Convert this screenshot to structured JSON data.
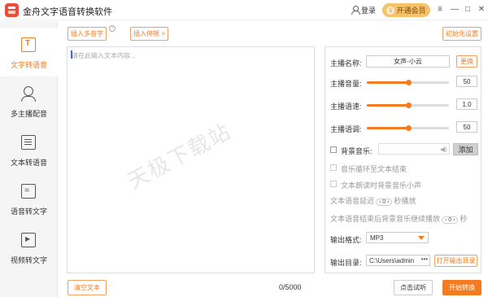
{
  "app": {
    "title": "金舟文字语音转换软件"
  },
  "header": {
    "login": "登录",
    "vip": "开通会员",
    "vip_icon": "♕"
  },
  "window": {
    "menu": "≡",
    "minimize": "—",
    "maximize": "□",
    "close": "✕"
  },
  "sidebar": {
    "items": [
      {
        "label": "文字转语音",
        "icon": "text-to-speech-icon"
      },
      {
        "label": "多主播配音",
        "icon": "multi-speaker-icon"
      },
      {
        "label": "文本转语音",
        "icon": "document-icon"
      },
      {
        "label": "语音转文字",
        "icon": "speech-to-text-icon"
      },
      {
        "label": "视频转文字",
        "icon": "video-icon"
      }
    ]
  },
  "toolbar": {
    "insert_polyphone": "插入多音字",
    "help": "?",
    "insert_pause": "插入停顿 >",
    "reset": "初始化设置"
  },
  "editor": {
    "placeholder": "请在此输入文本内容...",
    "watermark": "天极下载站",
    "counter": "0/5000"
  },
  "settings": {
    "anchor_label": "主播名称:",
    "anchor_value": "女声-小云",
    "change": "更换",
    "volume_label": "主播音量:",
    "volume_value": "50",
    "volume_level": 0.5,
    "speed_label": "主播语速:",
    "speed_value": "1.0",
    "speed_level": 0.5,
    "pitch_label": "主播语调:",
    "pitch_value": "50",
    "pitch_level": 0.5,
    "bg_music_label": "背景音乐:",
    "add": "添加",
    "loop_label": "音乐循环至文本结束",
    "lower_label": "文本朗读时背景音乐小声",
    "delay_prefix": "文本语音延迟",
    "delay_value": "0",
    "delay_suffix": "秒播放",
    "continue_prefix": "文本语音结束后背景音乐继续播放",
    "continue_value": "0",
    "continue_suffix": "秒",
    "format_label": "输出格式:",
    "format_value": "MP3",
    "dir_label": "输出目录:",
    "dir_value": "C:\\Users\\admin",
    "dir_more": "•••",
    "open_dir": "打开输出目录"
  },
  "footer": {
    "clear": "清空文本",
    "preview": "点击试听",
    "start": "开始转换"
  },
  "colors": {
    "accent": "#f47b20",
    "vip": "#f6c26a",
    "logo": "#f04a3a"
  }
}
